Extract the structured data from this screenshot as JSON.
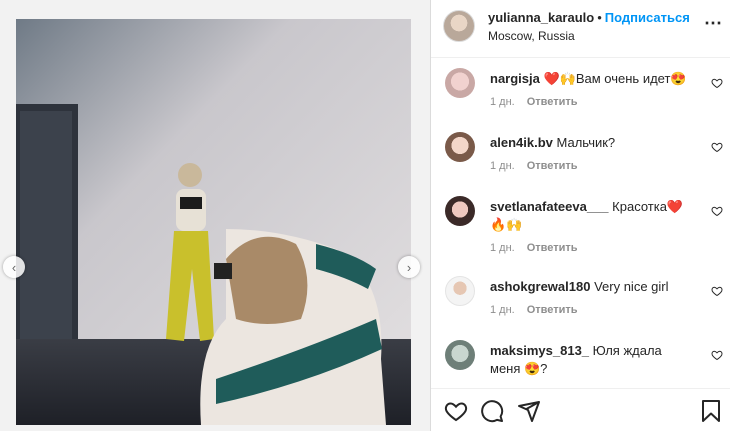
{
  "header": {
    "username": "yulianna_karaulo",
    "separator": "•",
    "follow_label": "Подписаться",
    "location": "Moscow, Russia",
    "more_icon": "more-horizontal-icon"
  },
  "post": {
    "image_description_icon": "post-photo",
    "prev_icon": "chevron-left-icon",
    "next_icon": "chevron-right-icon"
  },
  "comments": [
    {
      "username": "nargisja",
      "text": "❤️🙌Вам очень идет😍",
      "time": "1 дн.",
      "reply": "Ответить"
    },
    {
      "username": "alen4ik.bv",
      "text": "Мальчик?",
      "time": "1 дн.",
      "reply": "Ответить"
    },
    {
      "username": "svetlanafateeva___",
      "text": "Красотка❤️🔥🙌",
      "time": "1 дн.",
      "reply": "Ответить"
    },
    {
      "username": "ashokgrewal180",
      "text": "Very nice girl",
      "time": "1 дн.",
      "reply": "Ответить"
    },
    {
      "username": "maksimys_813_",
      "text": "Юля ждала меня 😍?",
      "time": "",
      "reply": ""
    }
  ],
  "actions": {
    "like_icon": "heart-icon",
    "comment_icon": "comment-icon",
    "share_icon": "send-icon",
    "save_icon": "bookmark-icon"
  },
  "colors": {
    "accent": "#0095f6",
    "muted": "#8e8e8e",
    "text": "#262626"
  }
}
